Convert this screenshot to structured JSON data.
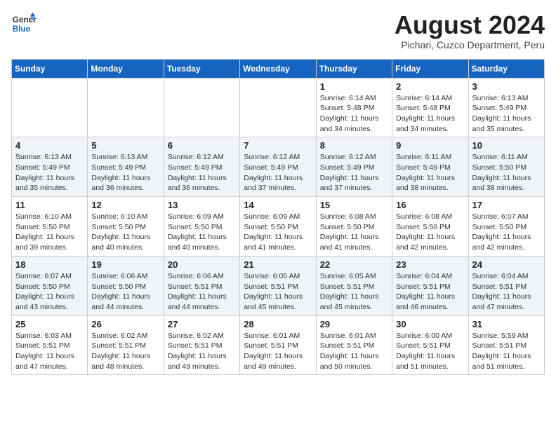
{
  "header": {
    "logo": {
      "general": "General",
      "blue": "Blue"
    },
    "title": "August 2024",
    "location": "Pichari, Cuzco Department, Peru"
  },
  "calendar": {
    "weekdays": [
      "Sunday",
      "Monday",
      "Tuesday",
      "Wednesday",
      "Thursday",
      "Friday",
      "Saturday"
    ],
    "weeks": [
      [
        {
          "day": "",
          "info": ""
        },
        {
          "day": "",
          "info": ""
        },
        {
          "day": "",
          "info": ""
        },
        {
          "day": "",
          "info": ""
        },
        {
          "day": "1",
          "info": "Sunrise: 6:14 AM\nSunset: 5:48 PM\nDaylight: 11 hours\nand 34 minutes."
        },
        {
          "day": "2",
          "info": "Sunrise: 6:14 AM\nSunset: 5:48 PM\nDaylight: 11 hours\nand 34 minutes."
        },
        {
          "day": "3",
          "info": "Sunrise: 6:13 AM\nSunset: 5:49 PM\nDaylight: 11 hours\nand 35 minutes."
        }
      ],
      [
        {
          "day": "4",
          "info": "Sunrise: 6:13 AM\nSunset: 5:49 PM\nDaylight: 11 hours\nand 35 minutes."
        },
        {
          "day": "5",
          "info": "Sunrise: 6:13 AM\nSunset: 5:49 PM\nDaylight: 11 hours\nand 36 minutes."
        },
        {
          "day": "6",
          "info": "Sunrise: 6:12 AM\nSunset: 5:49 PM\nDaylight: 11 hours\nand 36 minutes."
        },
        {
          "day": "7",
          "info": "Sunrise: 6:12 AM\nSunset: 5:49 PM\nDaylight: 11 hours\nand 37 minutes."
        },
        {
          "day": "8",
          "info": "Sunrise: 6:12 AM\nSunset: 5:49 PM\nDaylight: 11 hours\nand 37 minutes."
        },
        {
          "day": "9",
          "info": "Sunrise: 6:11 AM\nSunset: 5:49 PM\nDaylight: 11 hours\nand 38 minutes."
        },
        {
          "day": "10",
          "info": "Sunrise: 6:11 AM\nSunset: 5:50 PM\nDaylight: 11 hours\nand 38 minutes."
        }
      ],
      [
        {
          "day": "11",
          "info": "Sunrise: 6:10 AM\nSunset: 5:50 PM\nDaylight: 11 hours\nand 39 minutes."
        },
        {
          "day": "12",
          "info": "Sunrise: 6:10 AM\nSunset: 5:50 PM\nDaylight: 11 hours\nand 40 minutes."
        },
        {
          "day": "13",
          "info": "Sunrise: 6:09 AM\nSunset: 5:50 PM\nDaylight: 11 hours\nand 40 minutes."
        },
        {
          "day": "14",
          "info": "Sunrise: 6:09 AM\nSunset: 5:50 PM\nDaylight: 11 hours\nand 41 minutes."
        },
        {
          "day": "15",
          "info": "Sunrise: 6:08 AM\nSunset: 5:50 PM\nDaylight: 11 hours\nand 41 minutes."
        },
        {
          "day": "16",
          "info": "Sunrise: 6:08 AM\nSunset: 5:50 PM\nDaylight: 11 hours\nand 42 minutes."
        },
        {
          "day": "17",
          "info": "Sunrise: 6:07 AM\nSunset: 5:50 PM\nDaylight: 11 hours\nand 42 minutes."
        }
      ],
      [
        {
          "day": "18",
          "info": "Sunrise: 6:07 AM\nSunset: 5:50 PM\nDaylight: 11 hours\nand 43 minutes."
        },
        {
          "day": "19",
          "info": "Sunrise: 6:06 AM\nSunset: 5:50 PM\nDaylight: 11 hours\nand 44 minutes."
        },
        {
          "day": "20",
          "info": "Sunrise: 6:06 AM\nSunset: 5:51 PM\nDaylight: 11 hours\nand 44 minutes."
        },
        {
          "day": "21",
          "info": "Sunrise: 6:05 AM\nSunset: 5:51 PM\nDaylight: 11 hours\nand 45 minutes."
        },
        {
          "day": "22",
          "info": "Sunrise: 6:05 AM\nSunset: 5:51 PM\nDaylight: 11 hours\nand 45 minutes."
        },
        {
          "day": "23",
          "info": "Sunrise: 6:04 AM\nSunset: 5:51 PM\nDaylight: 11 hours\nand 46 minutes."
        },
        {
          "day": "24",
          "info": "Sunrise: 6:04 AM\nSunset: 5:51 PM\nDaylight: 11 hours\nand 47 minutes."
        }
      ],
      [
        {
          "day": "25",
          "info": "Sunrise: 6:03 AM\nSunset: 5:51 PM\nDaylight: 11 hours\nand 47 minutes."
        },
        {
          "day": "26",
          "info": "Sunrise: 6:02 AM\nSunset: 5:51 PM\nDaylight: 11 hours\nand 48 minutes."
        },
        {
          "day": "27",
          "info": "Sunrise: 6:02 AM\nSunset: 5:51 PM\nDaylight: 11 hours\nand 49 minutes."
        },
        {
          "day": "28",
          "info": "Sunrise: 6:01 AM\nSunset: 5:51 PM\nDaylight: 11 hours\nand 49 minutes."
        },
        {
          "day": "29",
          "info": "Sunrise: 6:01 AM\nSunset: 5:51 PM\nDaylight: 11 hours\nand 50 minutes."
        },
        {
          "day": "30",
          "info": "Sunrise: 6:00 AM\nSunset: 5:51 PM\nDaylight: 11 hours\nand 51 minutes."
        },
        {
          "day": "31",
          "info": "Sunrise: 5:59 AM\nSunset: 5:51 PM\nDaylight: 11 hours\nand 51 minutes."
        }
      ]
    ]
  }
}
